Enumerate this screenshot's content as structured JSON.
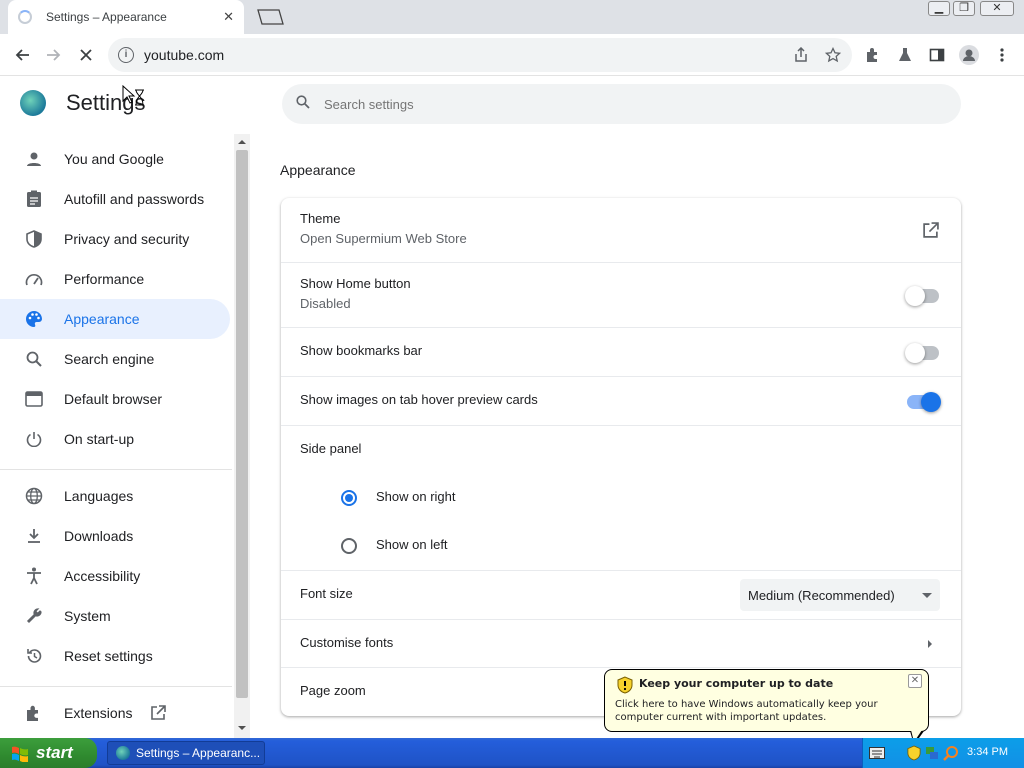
{
  "browser": {
    "tab_title": "Settings – Appearance",
    "url": "youtube.com"
  },
  "settings": {
    "title": "Settings",
    "search_placeholder": "Search settings",
    "section_title": "Appearance",
    "nav": [
      {
        "label": "You and Google",
        "icon": "person-icon"
      },
      {
        "label": "Autofill and passwords",
        "icon": "clipboard-icon"
      },
      {
        "label": "Privacy and security",
        "icon": "shield-icon"
      },
      {
        "label": "Performance",
        "icon": "speedometer-icon"
      },
      {
        "label": "Appearance",
        "icon": "palette-icon",
        "selected": true
      },
      {
        "label": "Search engine",
        "icon": "search-icon"
      },
      {
        "label": "Default browser",
        "icon": "browser-window-icon"
      },
      {
        "label": "On start-up",
        "icon": "power-icon"
      },
      {
        "label": "Languages",
        "icon": "globe-icon"
      },
      {
        "label": "Downloads",
        "icon": "download-icon"
      },
      {
        "label": "Accessibility",
        "icon": "accessibility-icon"
      },
      {
        "label": "System",
        "icon": "wrench-icon"
      },
      {
        "label": "Reset settings",
        "icon": "reset-icon"
      },
      {
        "label": "Extensions",
        "icon": "puzzle-icon"
      }
    ],
    "appearance": {
      "theme_label": "Theme",
      "theme_sub": "Open Supermium Web Store",
      "home_label": "Show Home button",
      "home_sub": "Disabled",
      "home_on": false,
      "bookmarks_label": "Show bookmarks bar",
      "bookmarks_on": false,
      "hover_label": "Show images on tab hover preview cards",
      "hover_on": true,
      "side_panel_label": "Side panel",
      "side_right": "Show on right",
      "side_left": "Show on left",
      "side_selected": "right",
      "font_size_label": "Font size",
      "font_size_value": "Medium (Recommended)",
      "customise_fonts_label": "Customise fonts",
      "page_zoom_label": "Page zoom"
    }
  },
  "balloon": {
    "title": "Keep your computer up to date",
    "body": "Click here to have Windows automatically keep your computer current with important updates."
  },
  "taskbar": {
    "start_label": "start",
    "task_label": "Settings – Appearanc...",
    "clock": "3:34 PM"
  },
  "colors": {
    "accent": "#1a73e8",
    "selected_bg": "#e8f0fe",
    "taskbar": "#245edb",
    "start_green": "#3c9e3c"
  }
}
